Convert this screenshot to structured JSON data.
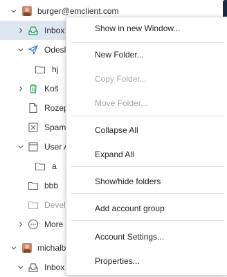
{
  "accounts": [
    {
      "name": "burger@emclient.com"
    },
    {
      "name": "michalb"
    }
  ],
  "folders": {
    "inbox": "Inbox",
    "sent": "Odesl",
    "hj": "hj",
    "trash": "Koš",
    "drafts": "Rozep",
    "spam": "Spam",
    "user": "User A",
    "a": "a",
    "bbb": "bbb",
    "devel": "Devel",
    "more": "More",
    "inbox2": "Inbox"
  },
  "context_menu": {
    "show_new_window": "Show in new Window...",
    "new_folder": "New Folder...",
    "copy_folder": "Copy Folder...",
    "move_folder": "Move Folder...",
    "collapse_all": "Collapse All",
    "expand_all": "Expand All",
    "show_hide_folders": "Show/hide folders",
    "add_account_group": "Add account group",
    "account_settings": "Account Settings...",
    "properties": "Properties..."
  },
  "colors": {
    "selection": "#dde6f1",
    "accent_green": "#2e9e5b",
    "accent_blue": "#2b6fd6"
  }
}
